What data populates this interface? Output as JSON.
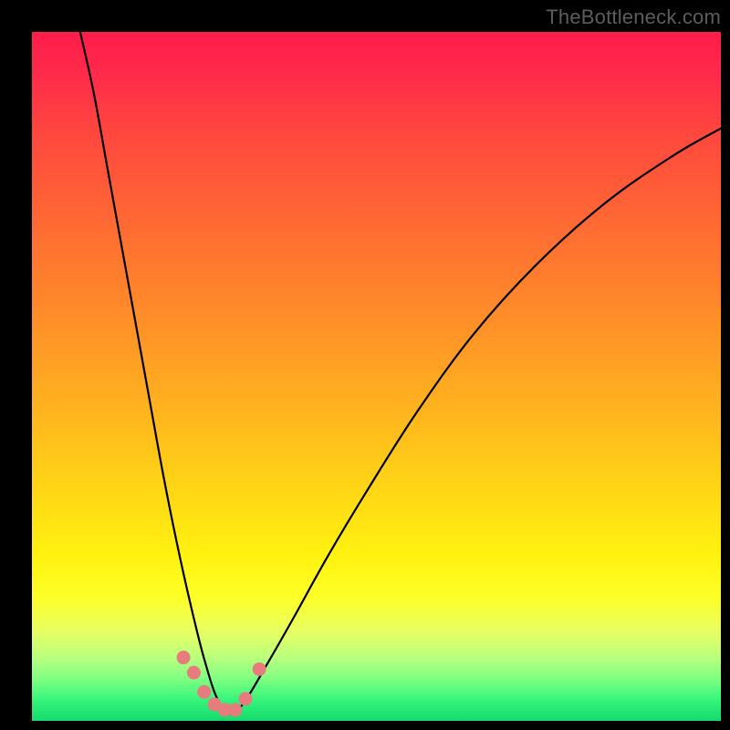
{
  "watermark": "TheBottleneck.com",
  "colors": {
    "frame": "#000000",
    "curve_stroke": "#000000",
    "marker_fill": "#e77b7d",
    "marker_stroke": "#c96062"
  },
  "chart_data": {
    "type": "line",
    "title": "",
    "xlabel": "",
    "ylabel": "",
    "xlim": [
      0,
      100
    ],
    "ylim": [
      0,
      100
    ],
    "description": "Bottleneck curve on rainbow gradient — V-shaped curve with minimum near x≈27; cluster of pink markers around the trough.",
    "series": [
      {
        "name": "bottleneck-curve",
        "x": [
          7,
          9,
          11,
          13,
          15,
          17,
          19,
          21,
          23,
          25,
          27,
          29,
          31,
          34,
          38,
          43,
          49,
          56,
          64,
          73,
          83,
          93,
          100
        ],
        "y": [
          100,
          91,
          80,
          69,
          58,
          47,
          36,
          26,
          17,
          9,
          3,
          1,
          3,
          8,
          15,
          24,
          34,
          45,
          56,
          66,
          75,
          82,
          86
        ]
      }
    ],
    "markers": {
      "name": "near-minimum-points",
      "x": [
        22.0,
        23.5,
        25.0,
        26.5,
        28.0,
        29.5,
        31.0,
        33.0
      ],
      "y": [
        9.2,
        7.0,
        4.2,
        2.4,
        1.6,
        1.6,
        3.2,
        7.5
      ]
    }
  }
}
